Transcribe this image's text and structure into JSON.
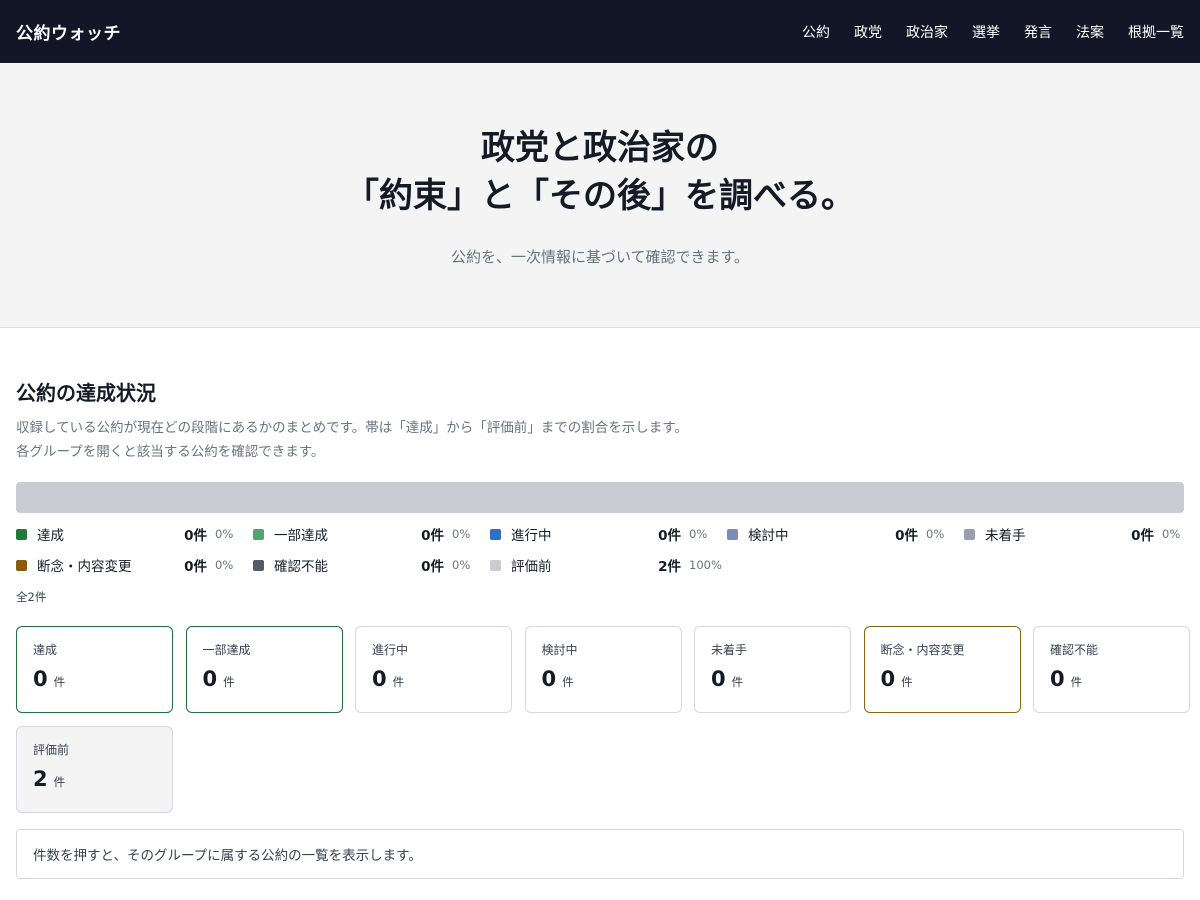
{
  "header": {
    "brand": "公約ウォッチ",
    "nav": [
      "公約",
      "政党",
      "政治家",
      "選挙",
      "発言",
      "法案",
      "根拠一覧"
    ]
  },
  "hero": {
    "title_line1": "政党と政治家の",
    "title_line2": "「約束」と「その後」を調べる。",
    "subtitle": "公約を、一次情報に基づいて確認できます。"
  },
  "status": {
    "title": "公約の達成状況",
    "description": "収録している公約が現在どの段階にあるかのまとめです。帯は「達成」から「評価前」までの割合を示します。各グループを開くと該当する公約を確認できます。",
    "total": "全2件",
    "categories": [
      {
        "label": "達成",
        "count": "0件",
        "pct": "0%",
        "color": "#1f7a3c",
        "share": 0
      },
      {
        "label": "一部達成",
        "count": "0件",
        "pct": "0%",
        "color": "#52a46a",
        "share": 0
      },
      {
        "label": "進行中",
        "count": "0件",
        "pct": "0%",
        "color": "#2f6fc4",
        "share": 0
      },
      {
        "label": "検討中",
        "count": "0件",
        "pct": "0%",
        "color": "#7d8bb8",
        "share": 0
      },
      {
        "label": "未着手",
        "count": "0件",
        "pct": "0%",
        "color": "#9aa0ab",
        "share": 0
      },
      {
        "label": "断念・内容変更",
        "count": "0件",
        "pct": "0%",
        "color": "#8a5a12",
        "share": 0
      },
      {
        "label": "確認不能",
        "count": "0件",
        "pct": "0%",
        "color": "#565b6b",
        "share": 0
      },
      {
        "label": "評価前",
        "count": "2件",
        "pct": "100%",
        "color": "#c9ccd3",
        "share": 1
      }
    ],
    "cards": [
      {
        "label": "達成",
        "num": "0",
        "unit": "件",
        "style": "green"
      },
      {
        "label": "一部達成",
        "num": "0",
        "unit": "件",
        "style": "green"
      },
      {
        "label": "進行中",
        "num": "0",
        "unit": "件",
        "style": ""
      },
      {
        "label": "検討中",
        "num": "0",
        "unit": "件",
        "style": ""
      },
      {
        "label": "未着手",
        "num": "0",
        "unit": "件",
        "style": ""
      },
      {
        "label": "断念・内容変更",
        "num": "0",
        "unit": "件",
        "style": "amber"
      },
      {
        "label": "確認不能",
        "num": "0",
        "unit": "件",
        "style": ""
      },
      {
        "label": "評価前",
        "num": "2",
        "unit": "件",
        "style": "muted"
      }
    ],
    "hint": "件数を押すと、そのグループに属する公約の一覧を表示します。"
  }
}
